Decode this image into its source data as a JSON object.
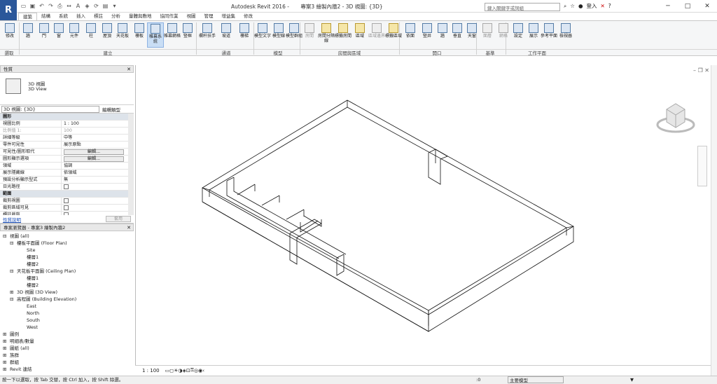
{
  "window": {
    "app_title": "Autodesk Revit 2016 -",
    "doc_title": "專案3 繪製內牆2 - 3D 視圖: {3D}",
    "search_placeholder": "鍵入關鍵字或詞組",
    "user": "登入",
    "help": "?"
  },
  "tabs": [
    "建築",
    "結構",
    "系統",
    "插入",
    "標註",
    "分析",
    "量體與敷地",
    "協同作業",
    "視圖",
    "管理",
    "增益集",
    "修改"
  ],
  "ribbon": {
    "buttons": [
      "修改",
      "牆",
      "門",
      "窗",
      "元件",
      "柱",
      "屋頂",
      "天花板",
      "樓板",
      "帷幕系統",
      "帷幕網格",
      "豎框",
      "欄杆扶手",
      "坡道",
      "樓梯",
      "模型文字",
      "模型線",
      "模型群組",
      "房間",
      "房間分隔線",
      "標籤房間",
      "區域",
      "區域邊界",
      "標籤區域",
      "依面",
      "豎井",
      "牆",
      "垂直",
      "天窗",
      "面層",
      "網格",
      "設定",
      "展示",
      "參考平面",
      "檢視器"
    ],
    "panels": {
      "select": "選取",
      "build": "建立",
      "circulation": "通道",
      "model": "模型",
      "room": "房間與區域",
      "opening": "開口",
      "datum": "基準",
      "workplane": "工作平面"
    }
  },
  "properties": {
    "header": "性質",
    "type_name": "3D 視圖",
    "type_sub": "3D View",
    "selector": "3D 視圖: {3D}",
    "edit_type": "編輯類型",
    "rows": [
      {
        "k": "圖形",
        "v": "",
        "g": true
      },
      {
        "k": "視圖比例",
        "v": "1 : 100"
      },
      {
        "k": "比例值 1:",
        "v": "100",
        "dim": true
      },
      {
        "k": "詳細等級",
        "v": "中等"
      },
      {
        "k": "零件可見性",
        "v": "展示原點"
      },
      {
        "k": "可見性/圖形取代",
        "v": "編輯...",
        "btn": true
      },
      {
        "k": "圖形顯示選項",
        "v": "編輯...",
        "btn": true
      },
      {
        "k": "領域",
        "v": "協調"
      },
      {
        "k": "展示隱藏線",
        "v": "依領域"
      },
      {
        "k": "預設分析顯示型式",
        "v": "無"
      },
      {
        "k": "日光路徑",
        "v": "",
        "chk": true
      },
      {
        "k": "範圍",
        "v": "",
        "g": true
      },
      {
        "k": "裁剪視圖",
        "v": "",
        "chk": true
      },
      {
        "k": "裁剪區域可見",
        "v": "",
        "chk": true
      },
      {
        "k": "標註裁剪",
        "v": "",
        "chk": true
      }
    ],
    "help_link": "性質說明",
    "apply": "套用"
  },
  "browser": {
    "header": "專案瀏覽器 - 專案3 繪製內牆2",
    "items": [
      "視圖 (all)",
      "樓板平面圖 (Floor Plan)",
      "Site",
      "樓層1",
      "樓層2",
      "天花板平面圖 (Ceiling Plan)",
      "樓層1",
      "樓層2",
      "3D 視圖 (3D View)",
      "高程圖 (Building Elevation)",
      "East",
      "North",
      "South",
      "West",
      "圖例",
      "明細表/數量",
      "圖紙 (all)",
      "族群",
      "群組",
      "Revit 連結"
    ]
  },
  "viewbar": {
    "scale": "1 : 100"
  },
  "status": {
    "hint": "按一下以選取，按 Tab 交替，按 Ctrl 加入，按 Shift 除選。",
    "count": ":0",
    "model": "主要模型"
  }
}
